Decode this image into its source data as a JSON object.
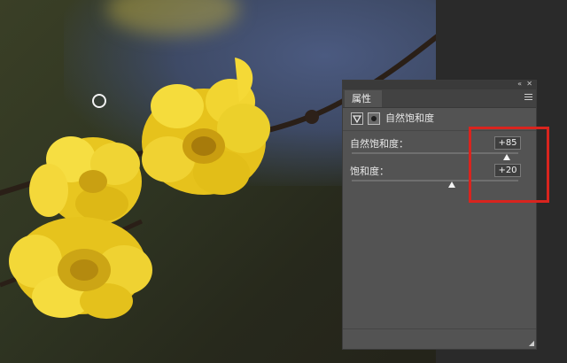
{
  "panel": {
    "tab_label": "属性",
    "adjustment_title": "自然饱和度",
    "sliders": [
      {
        "label": "自然饱和度：",
        "value": "+85",
        "level_fraction": 0.93
      },
      {
        "label": "饱和度：",
        "value": "+20",
        "level_fraction": 0.6
      }
    ],
    "icons": [
      "collapse-icon",
      "close-icon",
      "panel-menu-icon",
      "vibrance-adjustment-icon",
      "layer-mask-icon",
      "resize-grip-icon"
    ]
  },
  "colors": {
    "annotation_box": "#d9241e",
    "panel_bg": "#535353",
    "flower": "#f2d22a"
  }
}
